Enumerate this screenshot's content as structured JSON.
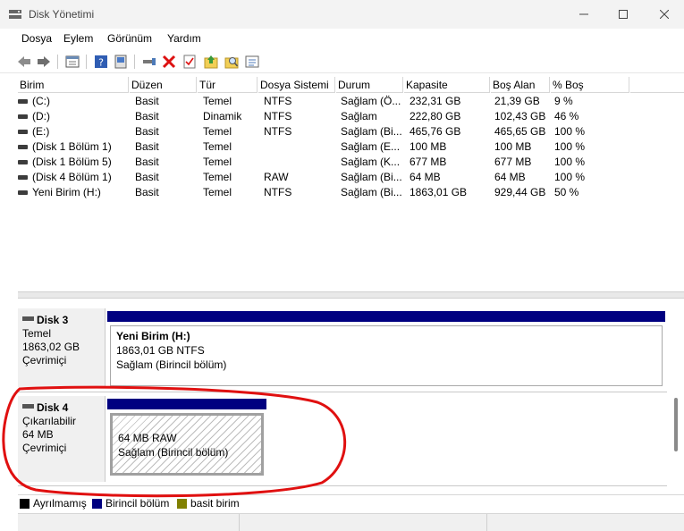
{
  "window": {
    "title": "Disk Yönetimi"
  },
  "menu": [
    "Dosya",
    "Eylem",
    "Görünüm",
    "Yardım"
  ],
  "toolbar": {
    "icons": [
      "back-icon",
      "forward-icon",
      "view-icon",
      "help-icon",
      "help-book-icon",
      "connect-icon",
      "delete-icon",
      "properties-icon",
      "up-icon",
      "search-icon",
      "list-icon"
    ]
  },
  "columns": [
    "Birim",
    "Düzen",
    "Tür",
    "Dosya Sistemi",
    "Durum",
    "Kapasite",
    "Boş Alan",
    "% Boş"
  ],
  "volumes": [
    [
      "(C:)",
      "Basit",
      "Temel",
      "NTFS",
      "Sağlam (Ö...",
      "232,31 GB",
      "21,39 GB",
      "9 %"
    ],
    [
      "(D:)",
      "Basit",
      "Dinamik",
      "NTFS",
      "Sağlam",
      "222,80 GB",
      "102,43 GB",
      "46 %"
    ],
    [
      "(E:)",
      "Basit",
      "Temel",
      "NTFS",
      "Sağlam (Bi...",
      "465,76 GB",
      "465,65 GB",
      "100 %"
    ],
    [
      "(Disk 1 Bölüm 1)",
      "Basit",
      "Temel",
      "",
      "Sağlam (E...",
      "100 MB",
      "100 MB",
      "100 %"
    ],
    [
      "(Disk 1 Bölüm 5)",
      "Basit",
      "Temel",
      "",
      "Sağlam (K...",
      "677 MB",
      "677 MB",
      "100 %"
    ],
    [
      "(Disk 4 Bölüm 1)",
      "Basit",
      "Temel",
      "RAW",
      "Sağlam (Bi...",
      "64 MB",
      "64 MB",
      "100 %"
    ],
    [
      "Yeni Birim (H:)",
      "Basit",
      "Temel",
      "NTFS",
      "Sağlam (Bi...",
      "1863,01 GB",
      "929,44 GB",
      "50 %"
    ]
  ],
  "disks": [
    {
      "name": "Disk 3",
      "type": "Temel",
      "size": "1863,02 GB",
      "status": "Çevrimiçi",
      "partition": {
        "title": "Yeni Birim  (H:)",
        "info": "1863,01 GB NTFS",
        "status": "Sağlam (Birincil bölüm)"
      }
    },
    {
      "name": "Disk 4",
      "type": "Çıkarılabilir",
      "size": "64 MB",
      "status": "Çevrimiçi",
      "partition": {
        "title": "",
        "info": "64 MB RAW",
        "status": "Sağlam (Birincil bölüm)"
      }
    }
  ],
  "legend": [
    {
      "label": "Ayrılmamış",
      "color": "#000000"
    },
    {
      "label": "Birincil bölüm",
      "color": "#000080"
    },
    {
      "label": "basit birim",
      "color": "#808000"
    }
  ],
  "colors": {
    "partition_bar": "#000080",
    "annotation": "#e01010"
  }
}
